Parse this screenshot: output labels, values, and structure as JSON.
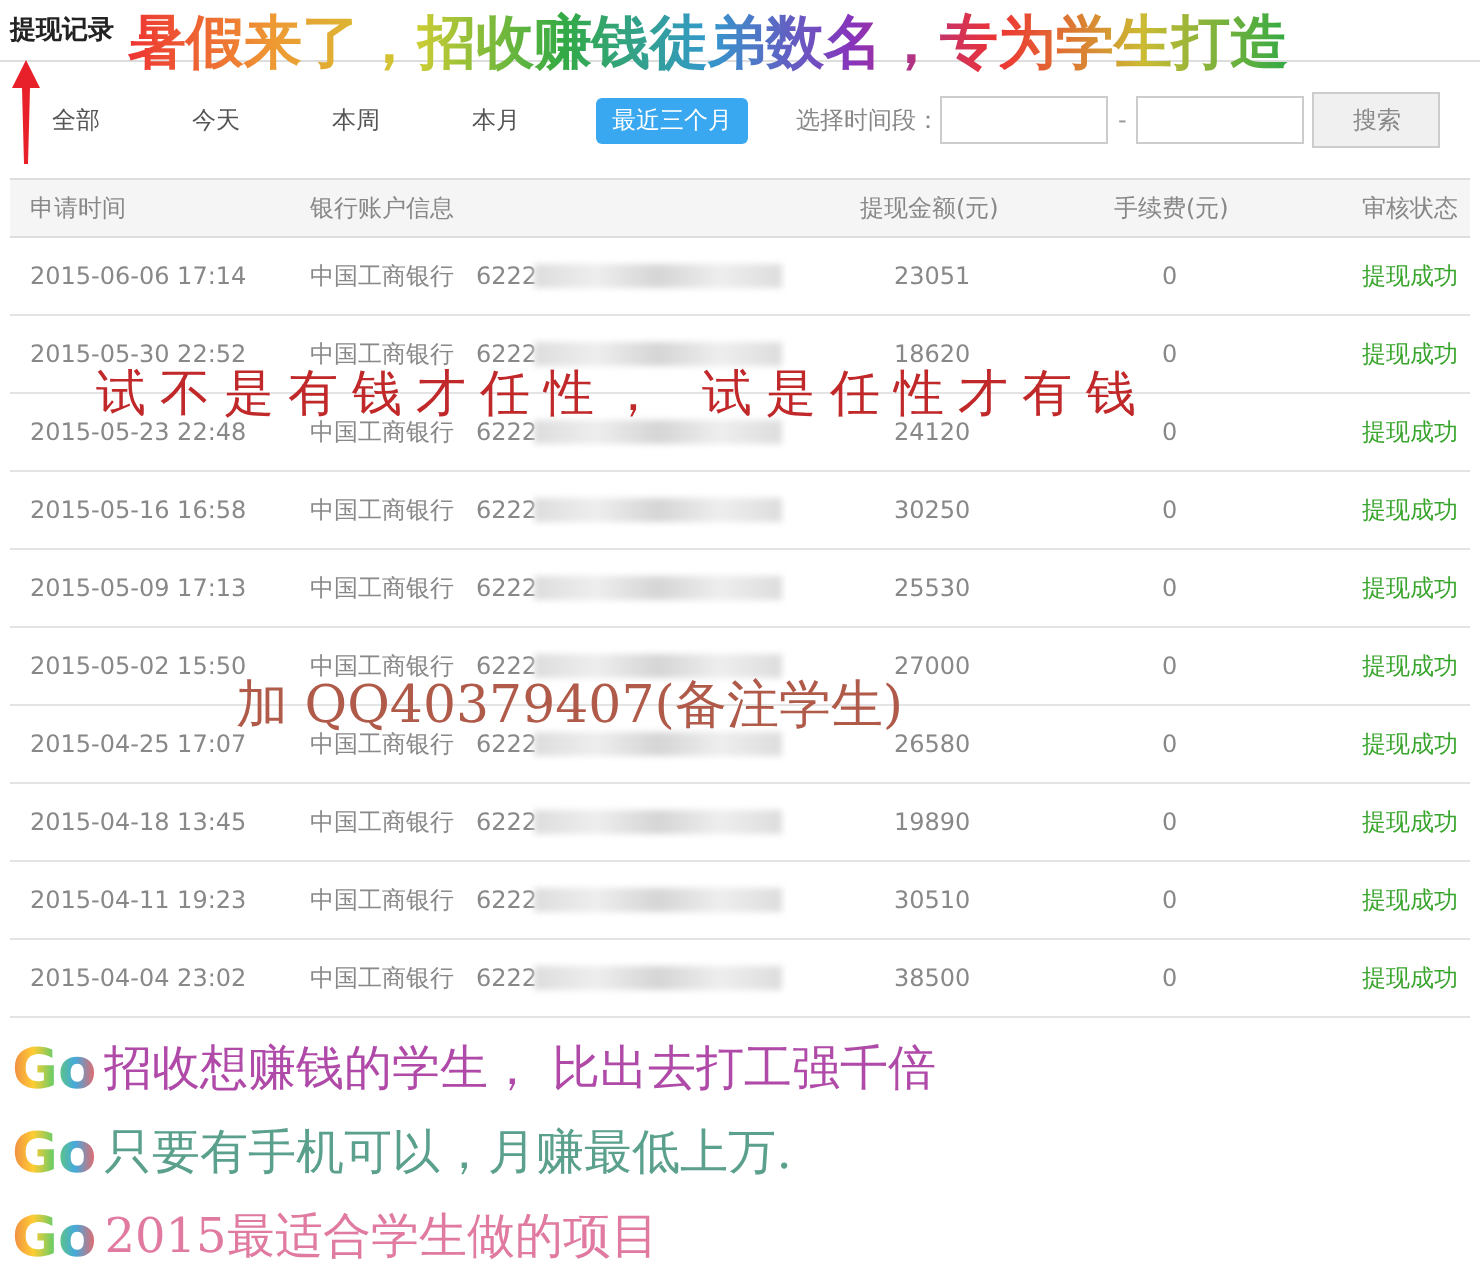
{
  "title": "提现记录",
  "filters": [
    {
      "label": "全部",
      "selected": false
    },
    {
      "label": "今天",
      "selected": false
    },
    {
      "label": "本周",
      "selected": false
    },
    {
      "label": "本月",
      "selected": false
    },
    {
      "label": "最近三个月",
      "selected": true
    }
  ],
  "date_range": {
    "label": "选择时间段：",
    "separator": "-",
    "button": "搜索"
  },
  "table": {
    "columns": [
      "申请时间",
      "银行账户信息",
      "提现金额(元)",
      "手续费(元)",
      "审核状态"
    ],
    "rows": [
      {
        "time": "2015-06-06 17:14",
        "bank": "中国工商银行",
        "card": "6222",
        "amount": "23051",
        "fee": "0",
        "status": "提现成功"
      },
      {
        "time": "2015-05-30 22:52",
        "bank": "中国工商银行",
        "card": "6222",
        "amount": "18620",
        "fee": "0",
        "status": "提现成功"
      },
      {
        "time": "2015-05-23 22:48",
        "bank": "中国工商银行",
        "card": "6222",
        "amount": "24120",
        "fee": "0",
        "status": "提现成功"
      },
      {
        "time": "2015-05-16 16:58",
        "bank": "中国工商银行",
        "card": "6222",
        "amount": "30250",
        "fee": "0",
        "status": "提现成功"
      },
      {
        "time": "2015-05-09 17:13",
        "bank": "中国工商银行",
        "card": "6222",
        "amount": "25530",
        "fee": "0",
        "status": "提现成功"
      },
      {
        "time": "2015-05-02 15:50",
        "bank": "中国工商银行",
        "card": "6222",
        "amount": "27000",
        "fee": "0",
        "status": "提现成功"
      },
      {
        "time": "2015-04-25 17:07",
        "bank": "中国工商银行",
        "card": "6222",
        "amount": "26580",
        "fee": "0",
        "status": "提现成功"
      },
      {
        "time": "2015-04-18 13:45",
        "bank": "中国工商银行",
        "card": "6222",
        "amount": "19890",
        "fee": "0",
        "status": "提现成功"
      },
      {
        "time": "2015-04-11 19:23",
        "bank": "中国工商银行",
        "card": "6222",
        "amount": "30510",
        "fee": "0",
        "status": "提现成功"
      },
      {
        "time": "2015-04-04 23:02",
        "bank": "中国工商银行",
        "card": "6222",
        "amount": "38500",
        "fee": "0",
        "status": "提现成功"
      }
    ]
  },
  "overlays": [
    {
      "kind": "rainbow",
      "text": "暑假来了，招收赚钱徒弟数名，专为学生打造"
    },
    {
      "kind": "redgreen",
      "text": "试不是有钱才任性， 试是任性才有钱"
    },
    {
      "kind": "brown",
      "text": "加 QQ40379407(备注学生)"
    }
  ],
  "ad_lines": [
    {
      "badge": "Go",
      "text": "招收想赚钱的学生， 比出去打工强千倍",
      "color": "#b04aa8"
    },
    {
      "badge": "Go",
      "text": "只要有手机可以，月赚最低上万.",
      "color": "#5aa08c"
    },
    {
      "badge": "Go",
      "text": "2015最适合学生做的项目",
      "color": "#e07aa0"
    }
  ]
}
